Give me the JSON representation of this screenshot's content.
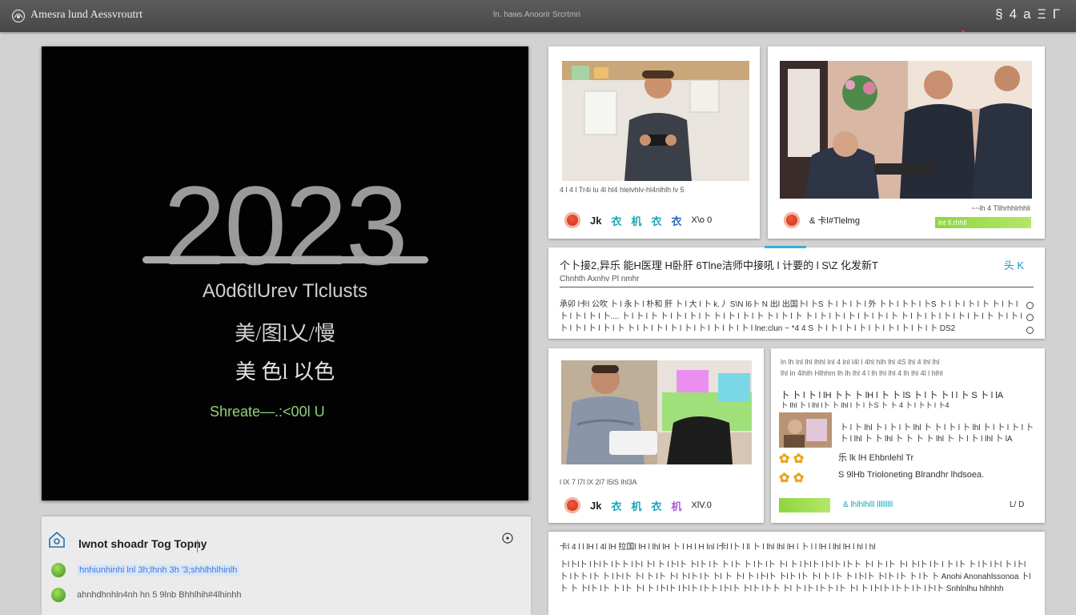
{
  "topbar": {
    "title": "Amesra lund Aessvroutrt",
    "subtitle": "ln. haws Anoorir Srcrtmri",
    "right_icons": [
      "§",
      "4",
      "a",
      "Ξ",
      "Γ"
    ]
  },
  "hero": {
    "year": "2023",
    "line1": "A0d6tlUrev Tlclusts",
    "line2": "美/图l乂/慢",
    "line3": "美 色l 以色",
    "line4": "Shreate—.:<00l U"
  },
  "bottom_panel": {
    "heading": "lwnot shoadr Tog Topny",
    "rows": [
      "hnhiunhinhi lnl 3h;lhnh 3h '3;shhlhhlhinlh",
      "ahnhdhnhln4nh hn 5 9lnb Bhhlhih#4lhinhh"
    ]
  },
  "card1": {
    "meta": "4 l 4 l Tr4i lu 4l hl4 hlelvhlv-hl4nlhlh lv 5",
    "icons": [
      "Jk",
      "衣",
      "机",
      "衣",
      "衣"
    ],
    "count": "X\\o 0"
  },
  "card2": {
    "meta_right": "~~lh 4 Tllhrhhlrhhli",
    "label": "& 卡l#Tlelmg",
    "bar_text": "lnt ll.rhhll"
  },
  "article": {
    "headline": "个卜接2,异乐 能H医理 H卧肝 6Tlne洁师中接吼 l 计要的 l S\\Z 化发新T",
    "tag": "头 K",
    "byline": "Chnhth Axnhv Pl nmhr",
    "body": "承卯 l卡l 公吹 卜 l 永卜 l 朴和 肝 卜 l 大 l 卜 k.丿 S\\N l6卜 N 出l 出国卜l 卜S 卜 l 卜 l 卜 l 外 卜卜 l 卜卜 l 卜S 卜 l 卜 l 卜 l 卜 卜 l 卜 l 卜 l 卜 l 卜 l 卜.... 卜 l 卜 l 卜 卜 l 卜 l 卜 l 卜 卜 l 卜 l 卜 l 卜 卜 l 卜 l 卜 卜 l 卜 l 卜 l 卜 l 卜 l 卜 l 卜 卜 l 卜 l 卜 l 卜 l 卜 l 卜 l 卜 卜 l 卜 l 卜 l 卜 l 卜 l 卜 l 卜 卜 l 卜 l 卜 l 卜 l 卜 l 卜 l 卜 l 卜 l 卜 l lne:clun ~ *4 4 S 卜 l 卜 l 卜 l 卜 l 卜 l 卜 l 卜 l 卜 l 卜 DS2"
  },
  "card3": {
    "meta": "l lX 7 l7l lX 2l7 l5lS lhl3A",
    "icons": [
      "Jk",
      "衣",
      "机",
      "衣",
      "机"
    ],
    "count": "XlV.0"
  },
  "news": {
    "lines": [
      "ln lh lnl lhl lhhl lnl 4 lnl l4l l 4hl hlh lhl 4S lhl 4 lhl lhl",
      "lhl ln 4lhlh Hlhhm lh lh lhl 4 l lh lhl lhl 4 lh lhl 4l l hlhl",
      "卜 卜 l 卜 l lH 卜卜 卜 lH l 卜 卜 lS 卜 l 卜 卜 l l 卜 S 卜 l lA",
      "卜 lhl 卜 l lhl l卜 卜 lhl l 卜 l 卜S 卜 卜 4 卜 l 卜卜 l 卜4",
      "卜 l 卜 lhl 卜 l 卜 l 卜 lhl 卜 卜 l 卜 l 卜 lhl 卜 l 卜 l 卜 l 卜",
      "卜 l lhl 卜 卜 lhl 卜 卜 卜 卜 lhl 卜 卜 l 卜 l lhl 卜 lA",
      "乐 lk lH Ehbnlehl Tr",
      "S 9lHb Trioloneting Blrandhr lhdsoea."
    ],
    "bottom_label": "& lhlhlhlll lllllllll",
    "count": "L/ D"
  },
  "long_article": {
    "headline": "卡l 4 l l lH l 4l lH 拉国l lH l lhl lH 卜 l H l H lnl l卡l l卜 l ll 卜 l lhl lhl lH l 卜 l l lH l lhl lH l hl l hl",
    "body": "卜l卜l卜 l卜l卜 l卜卜 l卜l 卜l 卜 l卜l卜 卜l卜 l卜 卜 l卜 卜 l卜 l卜 卜l 卜 l卜l卜 l卜l卜 l卜卜 卜l 卜 l卜 卜l 卜l卜 l卜 l 卜 l卜 卜 l卜 l卜l 卜 l卜l卜 l卜卜 l卜 卜 l卜l卜 卜l 卜 l卜 卜l 卜l卜 l卜 卜l 卜 卜l 卜 l卜l卜 卜l卜 l卜 卜l 卜 l卜 卜 l卜l卜 卜l卜 l卜 卜 l卜 卜 Anohi Anonahlssonoa 卜l卜 卜 卜l卜 l卜 卜 l卜 卜l 卜 l卜l卜 l卜l卜 l卜卜 l卜l卜 卜l卜 l卜卜 卜l 卜 l卜 l卜卜 l卜 卜l 卜 l卜l卜 l卜卜 l卜 l卜l卜 Snhlnlhu hlhhhh"
  },
  "colors": {
    "accent_blue": "#1a8fc9",
    "accent_green": "#8fd63e",
    "accent_red": "#d43a1f",
    "teal": "#18a4b8"
  }
}
